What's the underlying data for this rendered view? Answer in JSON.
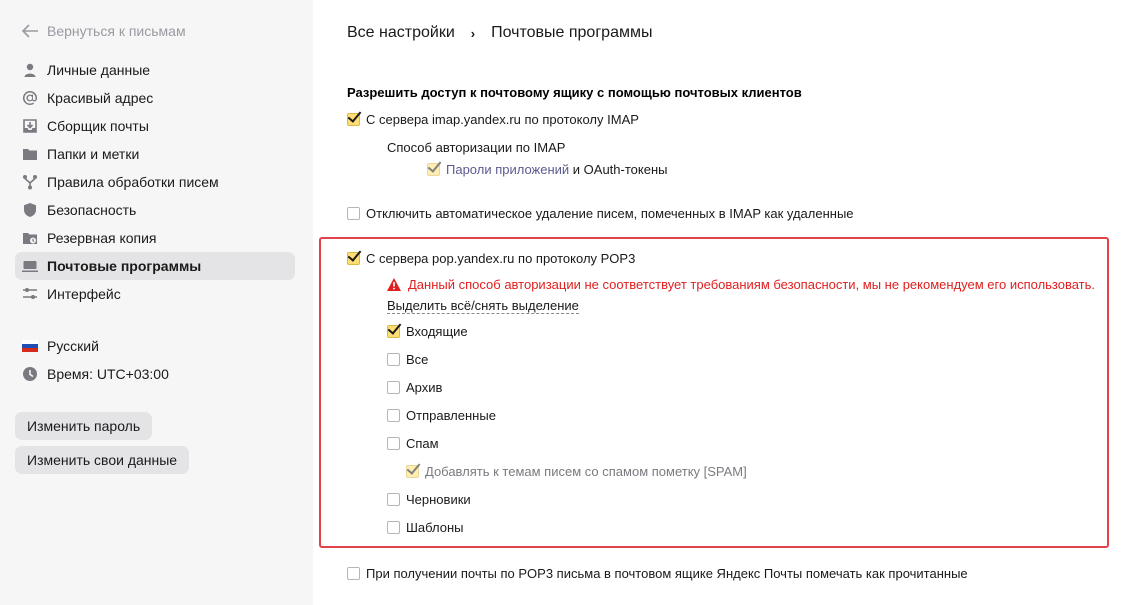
{
  "sidebar": {
    "back_label": "Вернуться к письмам",
    "items": [
      {
        "label": "Личные данные",
        "icon": "user-icon"
      },
      {
        "label": "Красивый адрес",
        "icon": "at-icon"
      },
      {
        "label": "Сборщик почты",
        "icon": "download-icon"
      },
      {
        "label": "Папки и метки",
        "icon": "folder-icon"
      },
      {
        "label": "Правила обработки писем",
        "icon": "fork-icon"
      },
      {
        "label": "Безопасность",
        "icon": "shield-icon"
      },
      {
        "label": "Резервная копия",
        "icon": "backup-folder-icon"
      },
      {
        "label": "Почтовые программы",
        "icon": "laptop-icon",
        "active": true
      },
      {
        "label": "Интерфейс",
        "icon": "sliders-icon"
      }
    ],
    "language": "Русский",
    "timezone": "Время: UTC+03:00",
    "change_password": "Изменить пароль",
    "change_data": "Изменить свои данные"
  },
  "breadcrumb": {
    "root": "Все настройки",
    "separator": "›",
    "current": "Почтовые программы"
  },
  "settings": {
    "section_title": "Разрешить доступ к почтовому ящику с помощью почтовых клиентов",
    "imap_label": "С сервера imap.yandex.ru по протоколу IMAP",
    "imap_checked": true,
    "imap_auth_title": "Способ авторизации по IMAP",
    "app_passwords_link": "Пароли приложений",
    "oauth_suffix": " и OAuth-токены",
    "app_passwords_checked": true,
    "disable_autodelete_label": "Отключить автоматическое удаление писем, помеченных в IMAP как удаленные",
    "disable_autodelete_checked": false,
    "pop3_label": "С сервера pop.yandex.ru по протоколу POP3",
    "pop3_checked": true,
    "pop3_warning": "Данный способ авторизации не соответствует требованиям безопасности, мы не рекомендуем его использовать.",
    "select_all": "Выделить всё/снять выделение",
    "folders": [
      {
        "label": "Входящие",
        "checked": true
      },
      {
        "label": "Все",
        "checked": false
      },
      {
        "label": "Архив",
        "checked": false
      },
      {
        "label": "Отправленные",
        "checked": false
      },
      {
        "label": "Спам",
        "checked": false
      }
    ],
    "spam_tag_label": "Добавлять к темам писем со спамом пометку [SPAM]",
    "spam_tag_checked": true,
    "folders_after": [
      {
        "label": "Черновики",
        "checked": false
      },
      {
        "label": "Шаблоны",
        "checked": false
      }
    ],
    "mark_read_label": "При получении почты по POP3 письма в почтовом ящике Яндекс Почты помечать как прочитанные",
    "mark_read_checked": false
  },
  "colors": {
    "highlight_border": "#e0434a",
    "warning_text": "#e02020",
    "checkbox_checked": "#ffdf73"
  }
}
